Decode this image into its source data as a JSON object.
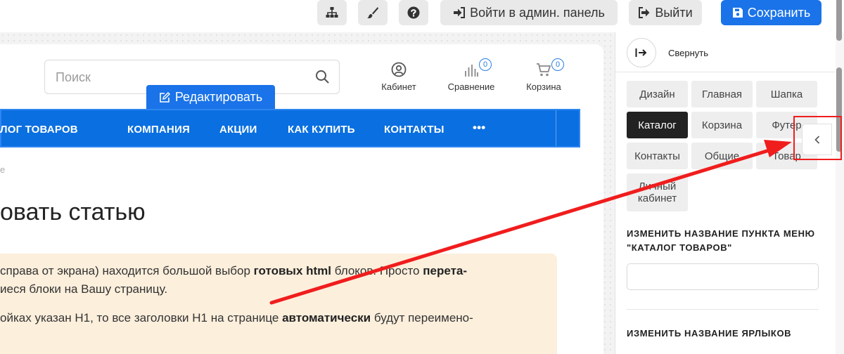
{
  "toolbar": {
    "admin_label": "Войти в админ. панель",
    "logout_label": "Выйти",
    "save_label": "Сохранить"
  },
  "site": {
    "search_placeholder": "Поиск",
    "header_icons": [
      {
        "label": "Кабинет"
      },
      {
        "label": "Сравнение",
        "count": "0"
      },
      {
        "label": "Корзина",
        "count": "0"
      }
    ],
    "edit_label": "Редактировать",
    "nav": [
      "ЛОГ ТОВАРОВ",
      "КОМПАНИЯ",
      "АКЦИИ",
      "КАК КУПИТЬ",
      "КОНТАКТЫ",
      "•••"
    ],
    "breadcrumb": "е",
    "page_title": "овать статью",
    "notice": {
      "line1_a": "справа от экрана) находится большой выбор ",
      "line1_b": "готовых html",
      "line1_c": " блоков. Просто ",
      "line1_d": "перета-",
      "line2": "иеся блоки на Вашу страницу.",
      "line3_a": "ойках указан H1, то все заголовки H1 на странице ",
      "line3_b": "автоматически",
      "line3_c": " будут переимено-"
    }
  },
  "panel": {
    "collapse_label": "Свернуть",
    "tabs": [
      "Дизайн",
      "Главная",
      "Шапка",
      "Каталог",
      "Корзина",
      "Футер",
      "Контакты",
      "Общие",
      "Товар",
      "Личный кабинет"
    ],
    "active_tab": "Каталог",
    "section1_title": "ИЗМЕНИТЬ НАЗВАНИЕ ПУНКТА МЕНЮ \"КАТАЛОГ ТОВАРОВ\"",
    "section2_title": "ИЗМЕНИТЬ НАЗВАНИЕ ЯРЛЫКОВ"
  },
  "colors": {
    "accent": "#1a73e8",
    "nav_bg": "#0a6fe0",
    "notice_bg": "#fcefdc",
    "annotation": "#f01d1d",
    "active_tab": "#222222"
  },
  "icons": [
    "sitemap-icon",
    "brush-icon",
    "question-circle-icon",
    "sign-in-icon",
    "sign-out-icon",
    "save-icon",
    "search-icon",
    "user-circle-icon",
    "bar-chart-icon",
    "cart-icon",
    "edit-icon",
    "collapse-arrow-icon",
    "chevron-left-icon"
  ]
}
